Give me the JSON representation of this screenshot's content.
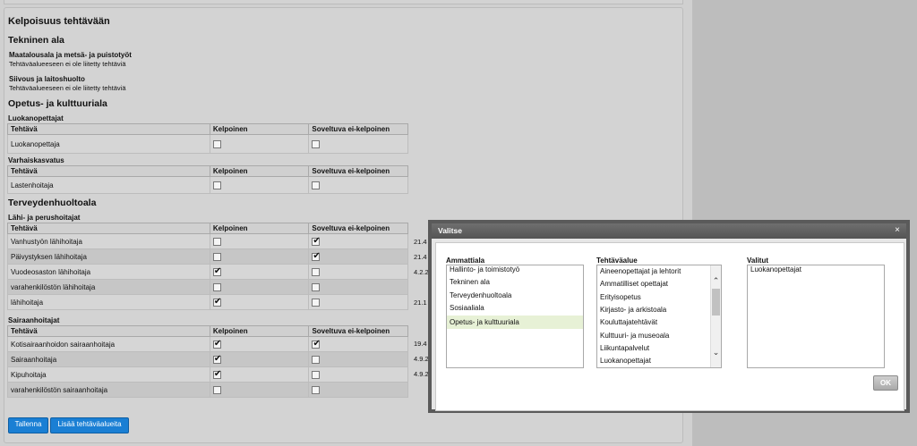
{
  "page": {
    "title": "Kelpoisuus tehtävään",
    "sections": [
      {
        "heading": "Tekninen ala",
        "subareas": [
          {
            "name": "Maatalousala ja metsä- ja puistotyöt",
            "note": "Tehtäväalueeseen ei ole liitetty tehtäviä"
          },
          {
            "name": "Siivous ja laitoshuolto",
            "note": "Tehtäväalueeseen ei ole liitetty tehtäviä"
          }
        ]
      },
      {
        "heading": "Opetus- ja kulttuuriala",
        "groups": [
          {
            "name": "Luokanopettajat",
            "rows": [
              {
                "task": "Luokanopettaja",
                "kelpoinen": false,
                "soveltuva": false
              }
            ]
          },
          {
            "name": "Varhaiskasvatus",
            "rows": [
              {
                "task": "Lastenhoitaja",
                "kelpoinen": false,
                "soveltuva": false
              }
            ]
          }
        ]
      },
      {
        "heading": "Terveydenhuoltoala",
        "groups": [
          {
            "name": "Lähi- ja perushoitajat",
            "rows": [
              {
                "task": "Vanhustyön lähihoitaja",
                "kelpoinen": false,
                "soveltuva": true,
                "date": "21.4"
              },
              {
                "task": "Päivystyksen lähihoitaja",
                "kelpoinen": false,
                "soveltuva": true,
                "date": "21.4"
              },
              {
                "task": "Vuodeosaston lähihoitaja",
                "kelpoinen": true,
                "soveltuva": false,
                "date": "4.2.2"
              },
              {
                "task": "varahenkilöstön lähihoitaja",
                "kelpoinen": false,
                "soveltuva": false,
                "date": ""
              },
              {
                "task": "lähihoitaja",
                "kelpoinen": true,
                "soveltuva": false,
                "date": "21.1"
              }
            ]
          },
          {
            "name": "Sairaanhoitajat",
            "rows": [
              {
                "task": "Kotisairaanhoidon sairaanhoitaja",
                "kelpoinen": true,
                "soveltuva": true,
                "date": "19.4"
              },
              {
                "task": "Sairaanhoitaja",
                "kelpoinen": true,
                "soveltuva": false,
                "date": "4.9.2"
              },
              {
                "task": "Kipuhoitaja",
                "kelpoinen": true,
                "soveltuva": false,
                "date": "4.9.2"
              },
              {
                "task": "varahenkilöstön sairaanhoitaja",
                "kelpoinen": false,
                "soveltuva": false,
                "date": ""
              }
            ]
          }
        ]
      }
    ],
    "columns": {
      "task": "Tehtävä",
      "kelpoinen": "Kelpoinen",
      "soveltuva": "Soveltuva ei-kelpoinen"
    },
    "buttons": {
      "save": "Tallenna",
      "add": "Lisää tehtäväalueita"
    }
  },
  "dialog": {
    "title": "Valitse",
    "close": "×",
    "col1": {
      "label": "Ammattiala",
      "items": [
        "Hallinto- ja toimistotyö",
        "Tekninen ala",
        "Terveydenhuoltoala",
        "Sosiaaliala",
        "Opetus- ja kulttuuriala"
      ],
      "selected": 4
    },
    "col2": {
      "label": "Tehtäväalue",
      "items": [
        "Aineenopettajat ja lehtorit",
        "Ammatilliset opettajat",
        "Erityisopetus",
        "Kirjasto- ja arkistoala",
        "Kouluttajatehtävät",
        "Kulttuuri- ja museoala",
        "Liikuntapalvelut",
        "Luokanopettajat"
      ]
    },
    "col3": {
      "label": "Valitut",
      "items": [
        "Luokanopettajat"
      ]
    },
    "ok": "OK"
  },
  "colors": {
    "button_blue": "#1a7fd4",
    "dialog_frame": "#5a5a5a",
    "selected_item": "#e7f1d6"
  }
}
